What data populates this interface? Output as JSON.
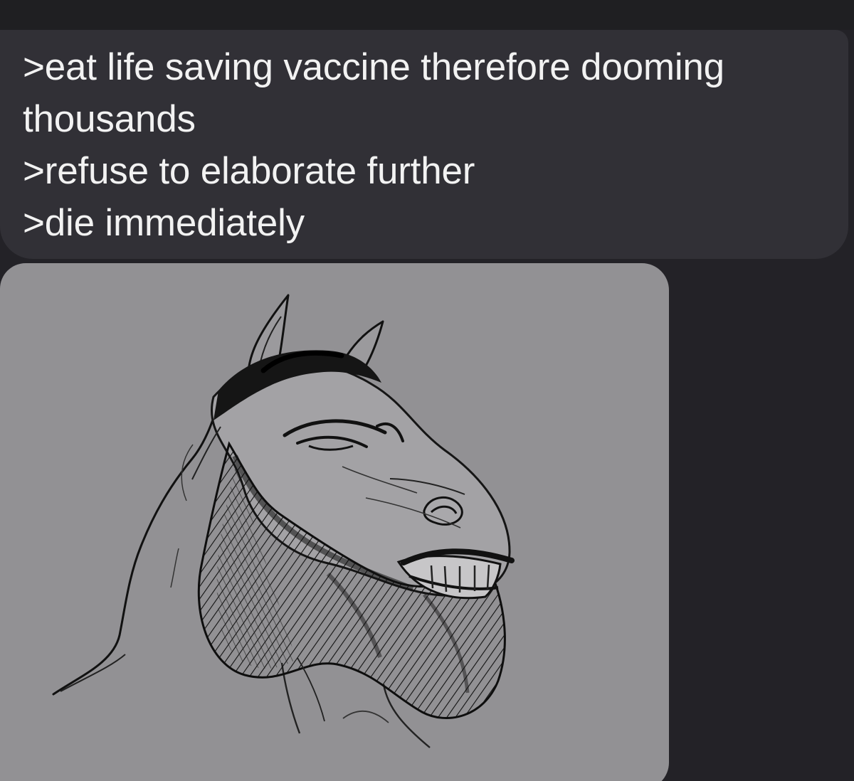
{
  "message": {
    "lines": [
      ">eat life saving vaccine therefore dooming",
      "thousands",
      ">refuse to elaborate further",
      ">die immediately"
    ]
  },
  "attachment": {
    "icon": "horse-drawing-image"
  },
  "colors": {
    "background": "#232227",
    "message_bubble": "#313036",
    "image_bubble": "#929194",
    "text": "#f2f2f2"
  }
}
